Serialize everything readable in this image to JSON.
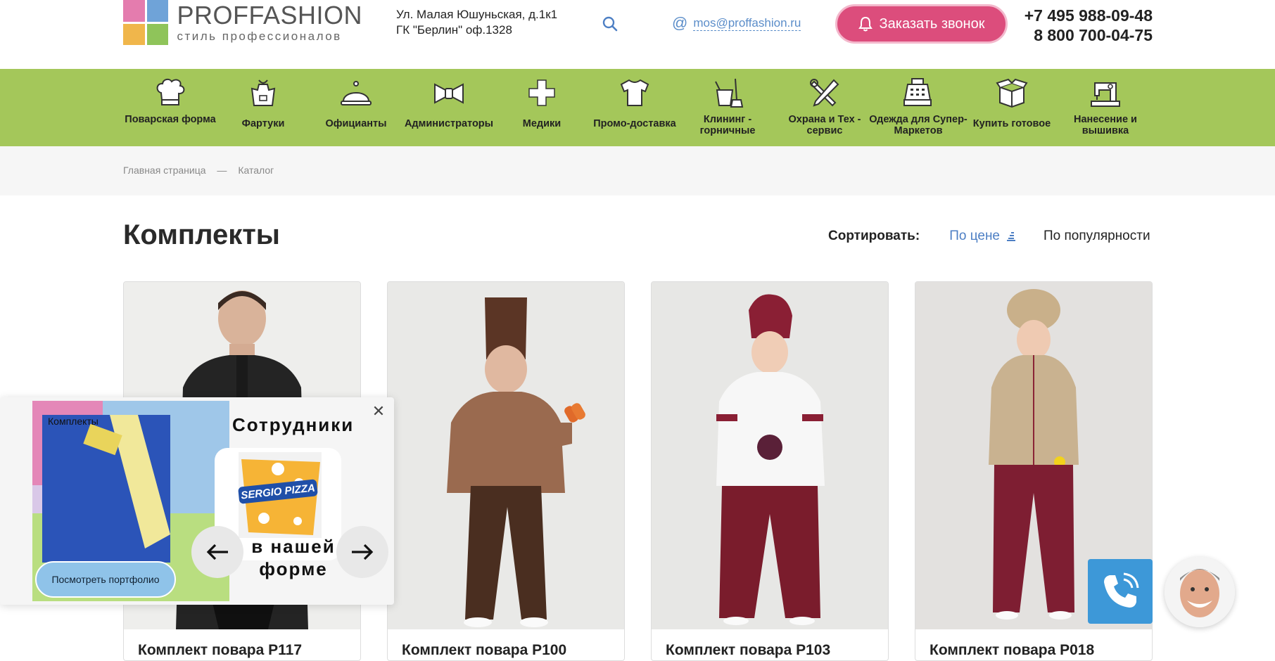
{
  "header": {
    "logo": {
      "name": "PROFFASHION",
      "slogan": "стиль профессионалов"
    },
    "address": {
      "line1": "Ул. Малая Юшуньская, д.1к1",
      "line2": "ГК \"Берлин\" оф.1328"
    },
    "email": "mos@proffashion.ru",
    "call_button": "Заказать звонок",
    "phones": [
      "+7 495 988-09-48",
      "8 800 700-04-75"
    ]
  },
  "categories": [
    {
      "label": "Поварская форма",
      "icon": "chef-hat-icon"
    },
    {
      "label": "Фартуки",
      "icon": "apron-icon"
    },
    {
      "label": "Официанты",
      "icon": "cloche-icon"
    },
    {
      "label": "Администраторы",
      "icon": "bow-tie-icon"
    },
    {
      "label": "Медики",
      "icon": "medical-cross-icon"
    },
    {
      "label": "Промо-доставка",
      "icon": "tshirt-icon"
    },
    {
      "label": "Клининг - горничные",
      "icon": "cleaning-bucket-icon"
    },
    {
      "label": "Охрана и Тех - сервис",
      "icon": "tools-icon"
    },
    {
      "label": "Одежда для Супер-Маркетов",
      "icon": "cash-register-icon"
    },
    {
      "label": "Купить готовое",
      "icon": "box-icon"
    },
    {
      "label": "Нанесение и вышивка",
      "icon": "sewing-machine-icon"
    }
  ],
  "breadcrumb": [
    "Главная страница",
    "—",
    "Каталог"
  ],
  "page_title": "Комплекты",
  "sort": {
    "label": "Сортировать:",
    "by_price": "По цене",
    "by_popularity": "По популярности"
  },
  "products": [
    {
      "name": "Комплект повара P117"
    },
    {
      "name": "Комплект повара P100"
    },
    {
      "name": "Комплект повара P103"
    },
    {
      "name": "Комплект повара P018"
    }
  ],
  "popup": {
    "photo_label": "Комплекты",
    "title": "Сотрудники",
    "brand": "SERGIO PIZZA",
    "subtitle": "в нашей форме",
    "portfolio_button": "Посмотреть портфолио",
    "close": "✕"
  },
  "colors": {
    "nav_green": "#a4c75a",
    "call_pink": "#dc4d7c",
    "link_blue": "#4d7fc4",
    "widget_blue": "#3d98d8"
  }
}
